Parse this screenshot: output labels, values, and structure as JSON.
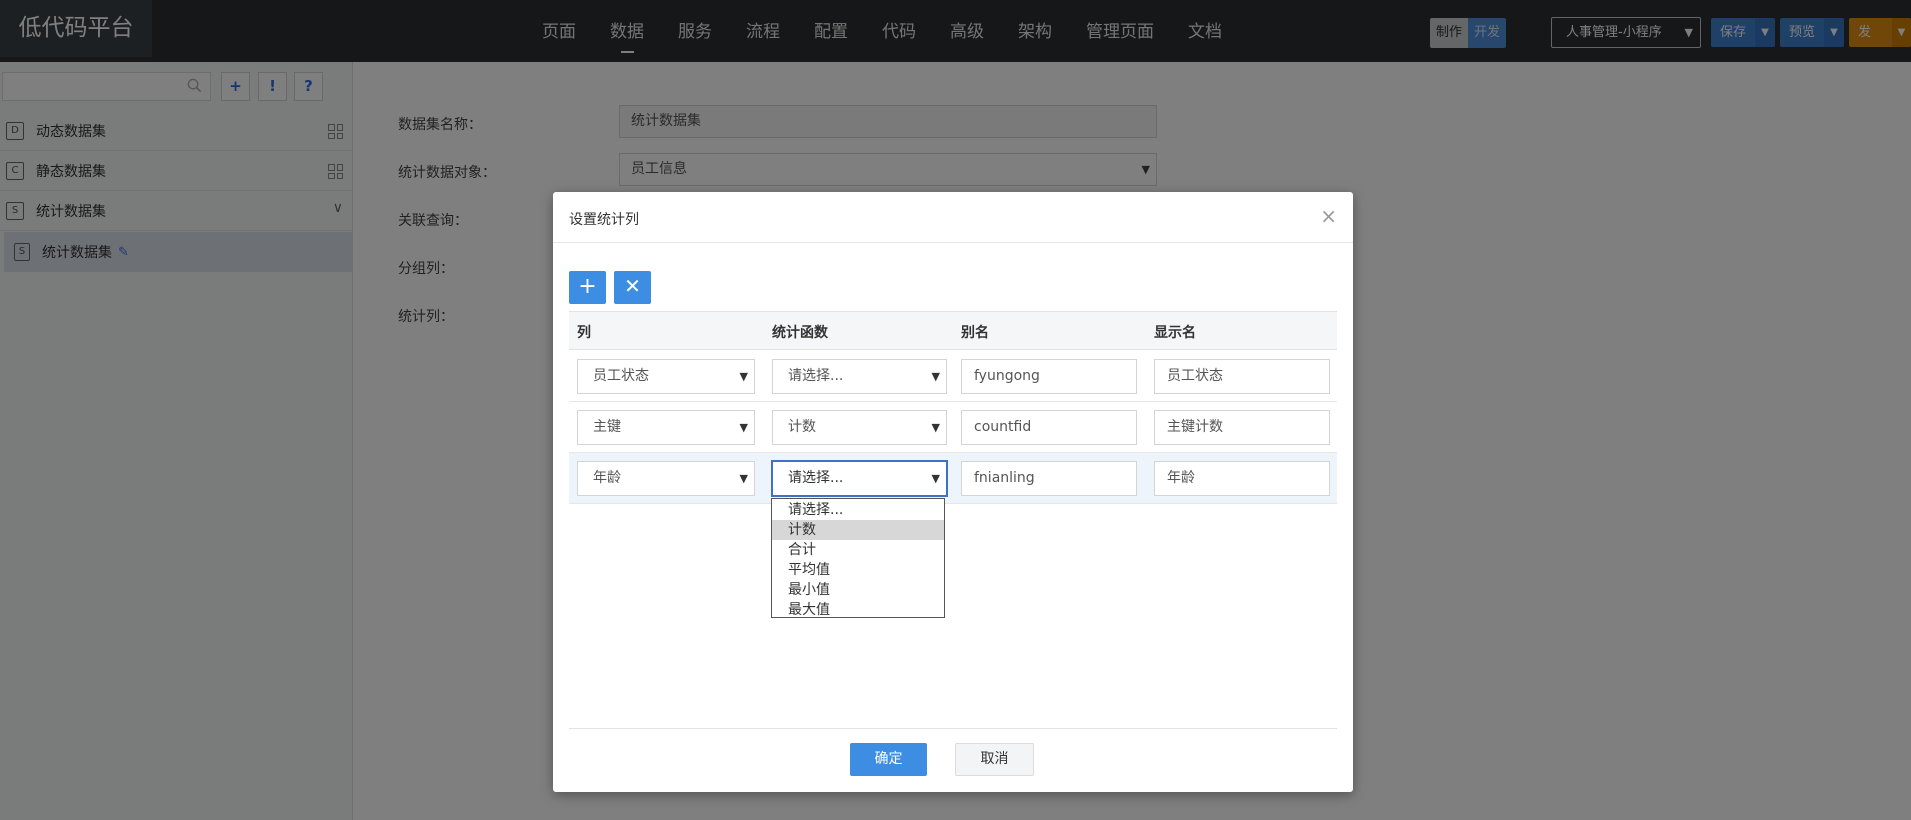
{
  "app": {
    "title": "低代码平台"
  },
  "nav": {
    "items": [
      "页面",
      "数据",
      "服务",
      "流程",
      "配置",
      "代码",
      "高级",
      "架构",
      "管理页面",
      "文档"
    ],
    "active": "数据"
  },
  "mode": {
    "design": "制作",
    "dev": "开发"
  },
  "project": {
    "selected": "人事管理-小程序"
  },
  "actions": {
    "save": "保存",
    "preview": "预览",
    "publish": "发布"
  },
  "sidebar": {
    "search_placeholder": "",
    "tools": [
      "+",
      "!",
      "?"
    ],
    "items": [
      {
        "label": "动态数据集",
        "icon": "D"
      },
      {
        "label": "静态数据集",
        "icon": "C"
      },
      {
        "label": "统计数据集",
        "icon": "S"
      }
    ],
    "child": {
      "label": "统计数据集",
      "icon": "S"
    }
  },
  "form": {
    "name_label": "数据集名称：",
    "name_value": "统计数据集",
    "object_label": "统计数据对象：",
    "object_value": "员工信息",
    "join_label": "关联查询：",
    "group_label": "分组列：",
    "stat_label": "统计列："
  },
  "modal": {
    "title": "设置统计列",
    "columns": [
      "列",
      "统计函数",
      "别名",
      "显示名"
    ],
    "rows": [
      {
        "column": "员工状态",
        "func": "请选择...",
        "alias": "fyungong",
        "display": "员工状态"
      },
      {
        "column": "主键",
        "func": "计数",
        "alias": "countfid",
        "display": "主键计数"
      },
      {
        "column": "年龄",
        "func": "请选择...",
        "alias": "fnianling",
        "display": "年龄"
      }
    ],
    "func_options": [
      "请选择...",
      "计数",
      "合计",
      "平均值",
      "最小值",
      "最大值"
    ],
    "func_options_hover": "计数",
    "ok": "确定",
    "cancel": "取消"
  },
  "colors": {
    "primary": "#3d8ee3",
    "topbar": "#2c2f33",
    "publish": "#e08e13"
  }
}
